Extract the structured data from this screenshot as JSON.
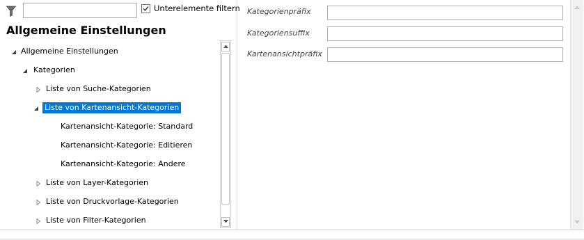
{
  "filter": {
    "icon": "filter-icon",
    "input_value": "",
    "checkbox_checked": true,
    "checkbox_label": "Unterelemente filtern"
  },
  "pane_title": "Allgemeine Einstellungen",
  "tree": [
    {
      "label": "Allgemeine Einstellungen",
      "level": 0,
      "state": "expanded",
      "selected": false
    },
    {
      "label": "Kategorien",
      "level": 1,
      "state": "expanded",
      "selected": false
    },
    {
      "label": "Liste von Suche-Kategorien",
      "level": 2,
      "state": "collapsed",
      "selected": false
    },
    {
      "label": "Liste von Kartenansicht-Kategorien",
      "level": 2,
      "state": "expanded",
      "selected": true
    },
    {
      "label": "Kartenansicht-Kategorie: Standard",
      "level": 3,
      "state": "leaf",
      "selected": false
    },
    {
      "label": "Kartenansicht-Kategorie: Editieren",
      "level": 3,
      "state": "leaf",
      "selected": false
    },
    {
      "label": "Kartenansicht-Kategorie: Andere",
      "level": 3,
      "state": "leaf",
      "selected": false
    },
    {
      "label": "Liste von Layer-Kategorien",
      "level": 2,
      "state": "collapsed",
      "selected": false
    },
    {
      "label": "Liste von Druckvorlage-Kategorien",
      "level": 2,
      "state": "collapsed",
      "selected": false
    },
    {
      "label": "Liste von Filter-Kategorien",
      "level": 2,
      "state": "collapsed",
      "selected": false
    }
  ],
  "properties": [
    {
      "label": "Kategorienpräfix",
      "value": ""
    },
    {
      "label": "Kategoriensuffix",
      "value": ""
    },
    {
      "label": "Kartenansichtpräfix",
      "value": ""
    }
  ],
  "colors": {
    "selection": "#0078d7",
    "selection_text": "#ffffff",
    "border": "#abadb3"
  }
}
